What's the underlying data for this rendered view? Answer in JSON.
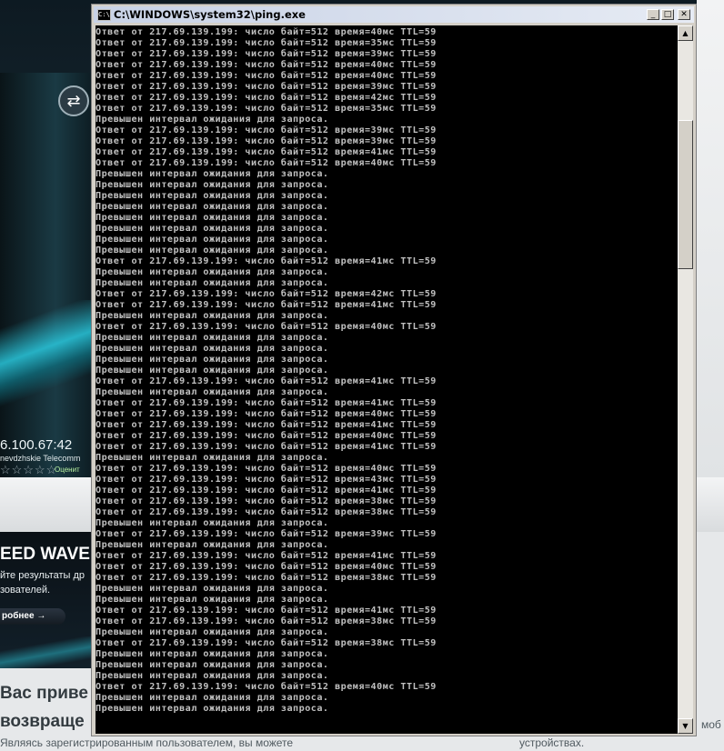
{
  "background_page": {
    "speed_test": {
      "icon": "speedtest-logo-icon",
      "ip": "6.100.67:42",
      "isp": "nevdzhskie Telecomm",
      "stars": "☆☆☆☆☆",
      "rate_label": "Оценит"
    },
    "promo": {
      "title": "EED WAVE",
      "line1": "йте результаты др",
      "line2": "зователей.",
      "button": "робнее →"
    },
    "welcome_line1": "Вас приве",
    "welcome_line2": "возвраще",
    "bottom_left": "Являясь зарегистрированным пользователем, вы можете",
    "bottom_right": "устройствах.",
    "side_right": "моб"
  },
  "window": {
    "title": "C:\\WINDOWS\\system32\\ping.exe",
    "icon": "cmd-icon",
    "icon_text": "C:\\",
    "minimize": "_",
    "maximize": "□",
    "close": "✕",
    "scroll_up": "▲",
    "scroll_down": "▼",
    "scroll_position": 0.15
  },
  "console_lines": [
    "Ответ от 217.69.139.199: число байт=512 время=40мс TTL=59",
    "Ответ от 217.69.139.199: число байт=512 время=35мс TTL=59",
    "Ответ от 217.69.139.199: число байт=512 время=39мс TTL=59",
    "Ответ от 217.69.139.199: число байт=512 время=40мс TTL=59",
    "Ответ от 217.69.139.199: число байт=512 время=40мс TTL=59",
    "Ответ от 217.69.139.199: число байт=512 время=39мс TTL=59",
    "Ответ от 217.69.139.199: число байт=512 время=42мс TTL=59",
    "Ответ от 217.69.139.199: число байт=512 время=35мс TTL=59",
    "Превышен интервал ожидания для запроса.",
    "Ответ от 217.69.139.199: число байт=512 время=39мс TTL=59",
    "Ответ от 217.69.139.199: число байт=512 время=39мс TTL=59",
    "Ответ от 217.69.139.199: число байт=512 время=41мс TTL=59",
    "Ответ от 217.69.139.199: число байт=512 время=40мс TTL=59",
    "Превышен интервал ожидания для запроса.",
    "Превышен интервал ожидания для запроса.",
    "Превышен интервал ожидания для запроса.",
    "Превышен интервал ожидания для запроса.",
    "Превышен интервал ожидания для запроса.",
    "Превышен интервал ожидания для запроса.",
    "Превышен интервал ожидания для запроса.",
    "Превышен интервал ожидания для запроса.",
    "Ответ от 217.69.139.199: число байт=512 время=41мс TTL=59",
    "Превышен интервал ожидания для запроса.",
    "Превышен интервал ожидания для запроса.",
    "Ответ от 217.69.139.199: число байт=512 время=42мс TTL=59",
    "Ответ от 217.69.139.199: число байт=512 время=41мс TTL=59",
    "Превышен интервал ожидания для запроса.",
    "Ответ от 217.69.139.199: число байт=512 время=40мс TTL=59",
    "Превышен интервал ожидания для запроса.",
    "Превышен интервал ожидания для запроса.",
    "Превышен интервал ожидания для запроса.",
    "Превышен интервал ожидания для запроса.",
    "Ответ от 217.69.139.199: число байт=512 время=41мс TTL=59",
    "Превышен интервал ожидания для запроса.",
    "Ответ от 217.69.139.199: число байт=512 время=41мс TTL=59",
    "Ответ от 217.69.139.199: число байт=512 время=40мс TTL=59",
    "Ответ от 217.69.139.199: число байт=512 время=41мс TTL=59",
    "Ответ от 217.69.139.199: число байт=512 время=40мс TTL=59",
    "Ответ от 217.69.139.199: число байт=512 время=41мс TTL=59",
    "Превышен интервал ожидания для запроса.",
    "Ответ от 217.69.139.199: число байт=512 время=40мс TTL=59",
    "Ответ от 217.69.139.199: число байт=512 время=43мс TTL=59",
    "Ответ от 217.69.139.199: число байт=512 время=41мс TTL=59",
    "Ответ от 217.69.139.199: число байт=512 время=38мс TTL=59",
    "Ответ от 217.69.139.199: число байт=512 время=38мс TTL=59",
    "Превышен интервал ожидания для запроса.",
    "Ответ от 217.69.139.199: число байт=512 время=39мс TTL=59",
    "Превышен интервал ожидания для запроса.",
    "Ответ от 217.69.139.199: число байт=512 время=41мс TTL=59",
    "Ответ от 217.69.139.199: число байт=512 время=40мс TTL=59",
    "Ответ от 217.69.139.199: число байт=512 время=38мс TTL=59",
    "Превышен интервал ожидания для запроса.",
    "Превышен интервал ожидания для запроса.",
    "Ответ от 217.69.139.199: число байт=512 время=41мс TTL=59",
    "Ответ от 217.69.139.199: число байт=512 время=38мс TTL=59",
    "Превышен интервал ожидания для запроса.",
    "Ответ от 217.69.139.199: число байт=512 время=38мс TTL=59",
    "Превышен интервал ожидания для запроса.",
    "Превышен интервал ожидания для запроса.",
    "Превышен интервал ожидания для запроса.",
    "Ответ от 217.69.139.199: число байт=512 время=40мс TTL=59",
    "Превышен интервал ожидания для запроса.",
    "Превышен интервал ожидания для запроса."
  ]
}
